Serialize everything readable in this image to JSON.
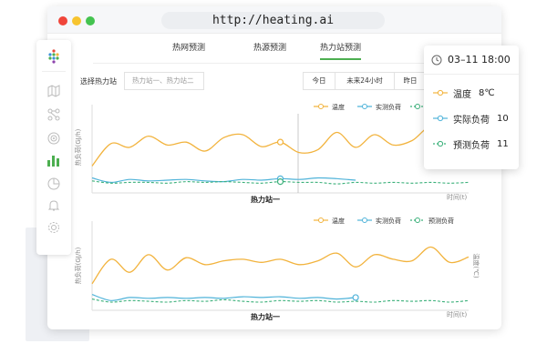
{
  "browser": {
    "url": "http://heating.ai"
  },
  "tabs": [
    {
      "label": "热网预测",
      "active": false
    },
    {
      "label": "热源预测",
      "active": false
    },
    {
      "label": "热力站预测",
      "active": true
    }
  ],
  "controls": {
    "station_label": "选择热力站",
    "station_placeholder": "热力站一、热力站二",
    "ranges": [
      "今日",
      "未来24小时",
      "昨日"
    ]
  },
  "sidebar": {
    "icons": [
      "logo-icon",
      "map-icon",
      "network-icon",
      "target-icon",
      "bar-chart-icon",
      "pie-chart-icon",
      "bell-icon",
      "settings-icon"
    ],
    "active": "bar-chart-icon"
  },
  "colors": {
    "temperature": "#f2b33d",
    "actual": "#4fb3d9",
    "predicted": "#3bb07a",
    "accent": "#4caf50"
  },
  "tooltip": {
    "time": "03–11  18:00",
    "rows": [
      {
        "label": "温度",
        "value": "8℃"
      },
      {
        "label": "实际负荷",
        "value": "10"
      },
      {
        "label": "预测负荷",
        "value": "11"
      }
    ]
  },
  "chart_data": [
    {
      "type": "line",
      "title": "热力站一",
      "xlabel": "时间(t)",
      "ylabel": "热负荷(GJ/h)",
      "legend": [
        "温度",
        "实测负荷",
        "预测负荷"
      ],
      "series": [
        {
          "name": "温度",
          "values": [
            30,
            60,
            55,
            70,
            58,
            62,
            50,
            68,
            72,
            56,
            62,
            48,
            52,
            75,
            55,
            72,
            58,
            64,
            82,
            60,
            85
          ]
        },
        {
          "name": "实测负荷",
          "values": [
            14,
            8,
            12,
            10,
            11,
            12,
            10,
            9,
            12,
            11,
            13,
            12,
            14,
            13,
            11
          ]
        },
        {
          "name": "预测负荷",
          "values": [
            10,
            7,
            8,
            8,
            7,
            9,
            8,
            9,
            8,
            7,
            9,
            8,
            8,
            6,
            8,
            7,
            8,
            7,
            8,
            7,
            8
          ]
        }
      ],
      "legend_position": "top-right",
      "grid": false
    },
    {
      "type": "line",
      "title": "热力站一",
      "xlabel": "时间(t)",
      "ylabel": "热负荷(GJ/h)",
      "y2label": "温度(℃)",
      "legend": [
        "温度",
        "实测负荷",
        "预测负荷"
      ],
      "series": [
        {
          "name": "温度",
          "values": [
            30,
            62,
            45,
            68,
            48,
            64,
            55,
            60,
            62,
            58,
            62,
            55,
            60,
            70,
            52,
            68,
            62,
            60,
            78,
            58,
            65
          ]
        },
        {
          "name": "实测负荷",
          "values": [
            16,
            8,
            12,
            11,
            12,
            11,
            12,
            11,
            13,
            12,
            13,
            11,
            12,
            10,
            12
          ]
        },
        {
          "name": "预测负荷",
          "values": [
            10,
            6,
            8,
            7,
            6,
            8,
            7,
            9,
            7,
            6,
            8,
            7,
            8,
            6,
            7,
            6,
            8,
            7,
            8,
            6,
            8
          ]
        }
      ],
      "legend_position": "top-right",
      "grid": false
    }
  ]
}
